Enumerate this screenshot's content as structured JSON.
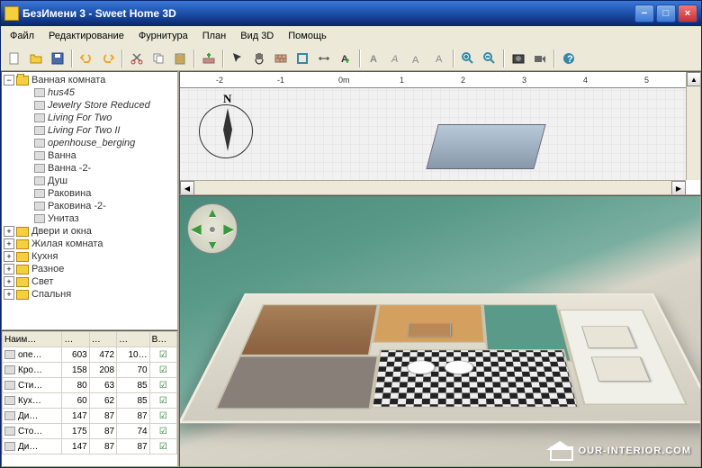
{
  "window": {
    "title": "БезИмени 3 - Sweet Home 3D"
  },
  "menu": {
    "file": "Файл",
    "edit": "Редактирование",
    "furniture": "Фурнитура",
    "plan": "План",
    "view3d": "Вид 3D",
    "help": "Помощь"
  },
  "tree": {
    "root": "Ванная комната",
    "items": [
      {
        "label": "hus45",
        "italic": true
      },
      {
        "label": "Jewelry Store Reduced",
        "italic": true
      },
      {
        "label": "Living For Two",
        "italic": true
      },
      {
        "label": "Living For Two II",
        "italic": true
      },
      {
        "label": "openhouse_berging",
        "italic": true
      },
      {
        "label": "Ванна",
        "italic": false
      },
      {
        "label": "Ванна -2-",
        "italic": false
      },
      {
        "label": "Душ",
        "italic": false
      },
      {
        "label": "Раковина",
        "italic": false
      },
      {
        "label": "Раковина -2-",
        "italic": false
      },
      {
        "label": "Унитаз",
        "italic": false
      }
    ],
    "categories": [
      "Двери и окна",
      "Жилая комната",
      "Кухня",
      "Разное",
      "Свет",
      "Спальня"
    ]
  },
  "table": {
    "headers": [
      "Наим…",
      "…",
      "…",
      "…",
      "В…"
    ],
    "rows": [
      {
        "name": "опе…",
        "c1": "603",
        "c2": "472",
        "c3": "10…",
        "vis": true
      },
      {
        "name": "Кро…",
        "c1": "158",
        "c2": "208",
        "c3": "70",
        "vis": true
      },
      {
        "name": "Сти…",
        "c1": "80",
        "c2": "63",
        "c3": "85",
        "vis": true
      },
      {
        "name": "Кух…",
        "c1": "60",
        "c2": "62",
        "c3": "85",
        "vis": true
      },
      {
        "name": "Ди…",
        "c1": "147",
        "c2": "87",
        "c3": "87",
        "vis": true
      },
      {
        "name": "Сто…",
        "c1": "175",
        "c2": "87",
        "c3": "74",
        "vis": true
      },
      {
        "name": "Ди…",
        "c1": "147",
        "c2": "87",
        "c3": "87",
        "vis": true
      }
    ]
  },
  "ruler": {
    "ticks": [
      "-2",
      "-1",
      "0m",
      "1",
      "2",
      "3",
      "4",
      "5"
    ]
  },
  "compass": {
    "north": "N"
  },
  "watermark": "OUR-INTERIOR.COM"
}
